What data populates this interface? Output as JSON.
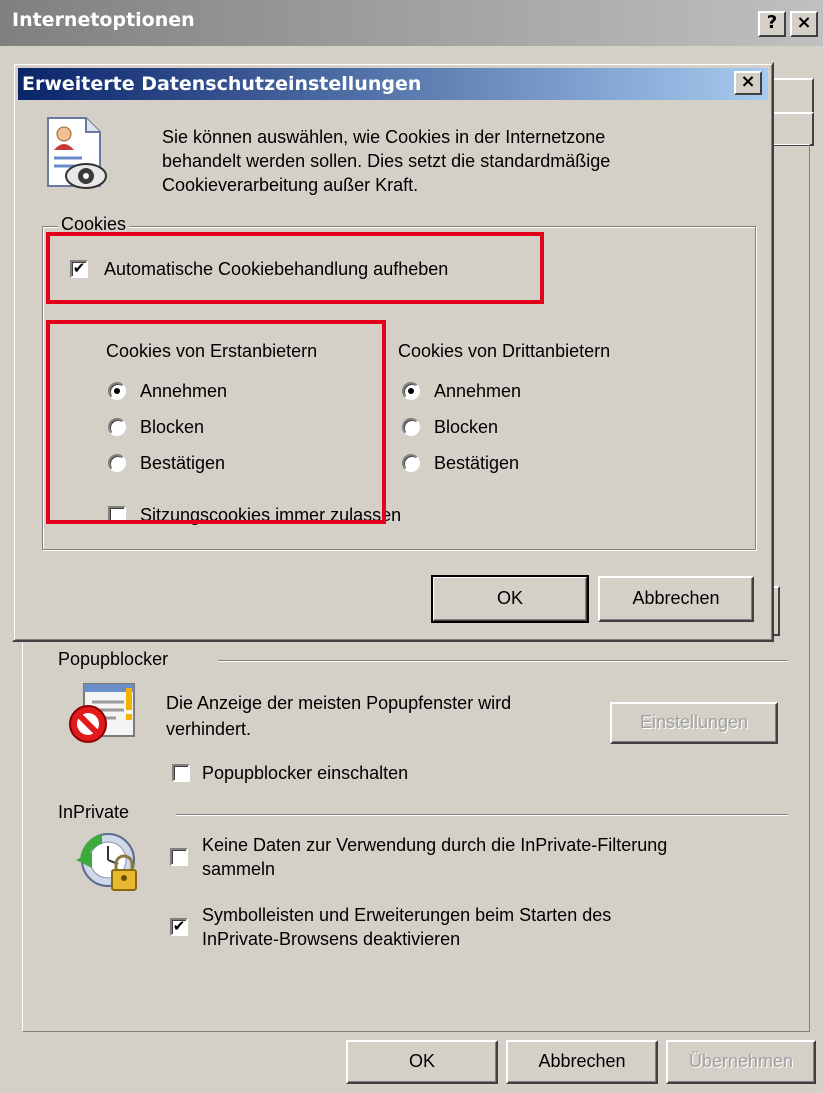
{
  "window": {
    "title": "Internetoptionen",
    "help_btn": "?",
    "close_btn": "×"
  },
  "popup": {
    "section_label": "Popupblocker",
    "icon": "popup-blocked-icon",
    "desc_line1": "Die Anzeige der meisten Popupfenster wird",
    "desc_line2": "verhindert.",
    "settings_btn": "Einstellungen",
    "enable_label": "Popupblocker einschalten",
    "enable_checked": false
  },
  "inprivate": {
    "section_label": "InPrivate",
    "icon": "inprivate-lock-icon",
    "opt1_line1": "Keine Daten zur Verwendung durch die InPrivate-Filterung",
    "opt1_line2": "sammeln",
    "opt1_checked": false,
    "opt2_line1": "Symbolleisten und Erweiterungen beim Starten des",
    "opt2_line2": "InPrivate-Browsens deaktivieren",
    "opt2_checked": true
  },
  "footer": {
    "ok": "OK",
    "cancel": "Abbrechen",
    "apply": "Übernehmen"
  },
  "dialog": {
    "title": "Erweiterte Datenschutzeinstellungen",
    "close_btn": "×",
    "icon": "privacy-document-eye-icon",
    "intro_line1": "Sie können auswählen, wie Cookies in der Internetzone",
    "intro_line2": "behandelt werden sollen. Dies setzt die standardmäßige",
    "intro_line3": "Cookieverarbeitung außer Kraft.",
    "group_title": "Cookies",
    "override_label": "Automatische Cookiebehandlung aufheben",
    "override_checked": true,
    "first_party": {
      "heading": "Cookies von Erstanbietern",
      "options": [
        "Annehmen",
        "Blocken",
        "Bestätigen"
      ],
      "selected": "Annehmen"
    },
    "third_party": {
      "heading": "Cookies von Drittanbietern",
      "options": [
        "Annehmen",
        "Blocken",
        "Bestätigen"
      ],
      "selected": "Annehmen"
    },
    "session_label": "Sitzungscookies immer zulassen",
    "session_checked": false,
    "ok": "OK",
    "cancel": "Abbrechen"
  },
  "highlight_color": "#e4001b"
}
